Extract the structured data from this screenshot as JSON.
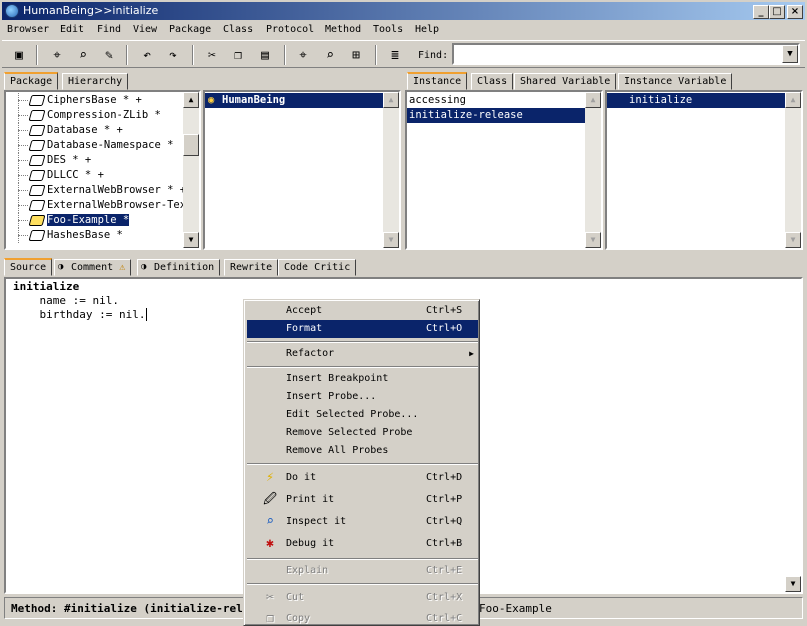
{
  "window": {
    "title": "HumanBeing>>initialize"
  },
  "menubar": [
    "Browser",
    "Edit",
    "Find",
    "View",
    "Package",
    "Class",
    "Protocol",
    "Method",
    "Tools",
    "Help"
  ],
  "toolbar": {
    "find_label": "Find:",
    "find_value": ""
  },
  "nav_tabs": [
    "Package",
    "Hierarchy"
  ],
  "packages": [
    "CiphersBase * +",
    "Compression-ZLib *",
    "Database * +",
    "Database-Namespace *",
    "DES * +",
    "DLLCC * +",
    "ExternalWebBrowser * +",
    "ExternalWebBrowser-Text",
    "Foo-Example *",
    "HashesBase *"
  ],
  "selected_package": "Foo-Example *",
  "classes": [
    "HumanBeing"
  ],
  "protocol_tabs": [
    "Instance",
    "Class",
    "Shared Variable",
    "Instance Variable"
  ],
  "protocols": [
    "accessing",
    "initialize-release"
  ],
  "methods": [
    "initialize"
  ],
  "code_tabs": [
    "Source",
    "Comment",
    "Definition",
    "Rewrite",
    "Code Critic"
  ],
  "code": [
    "initialize",
    "    name := nil.",
    "    birthday := nil."
  ],
  "status": "Method: #initialize (initialize-release) in HumanBeing in package Foo-Example",
  "status_left": "Method: #initialize (initialize-relea",
  "status_right": "Foo-Example",
  "context_menu": {
    "accept": {
      "label": "Accept",
      "shortcut": "Ctrl+S"
    },
    "format": {
      "label": "Format",
      "shortcut": "Ctrl+O"
    },
    "refactor": {
      "label": "Refactor"
    },
    "insert_breakpoint": {
      "label": "Insert Breakpoint"
    },
    "insert_probe": {
      "label": "Insert Probe..."
    },
    "edit_probe": {
      "label": "Edit Selected Probe..."
    },
    "remove_probe": {
      "label": "Remove Selected Probe"
    },
    "remove_all": {
      "label": "Remove All Probes"
    },
    "do_it": {
      "label": "Do it",
      "shortcut": "Ctrl+D"
    },
    "print_it": {
      "label": "Print it",
      "shortcut": "Ctrl+P"
    },
    "inspect_it": {
      "label": "Inspect it",
      "shortcut": "Ctrl+Q"
    },
    "debug_it": {
      "label": "Debug it",
      "shortcut": "Ctrl+B"
    },
    "explain": {
      "label": "Explain",
      "shortcut": "Ctrl+E"
    },
    "cut": {
      "label": "Cut",
      "shortcut": "Ctrl+X"
    },
    "copy": {
      "label": "Copy",
      "shortcut": "Ctrl+C"
    }
  }
}
